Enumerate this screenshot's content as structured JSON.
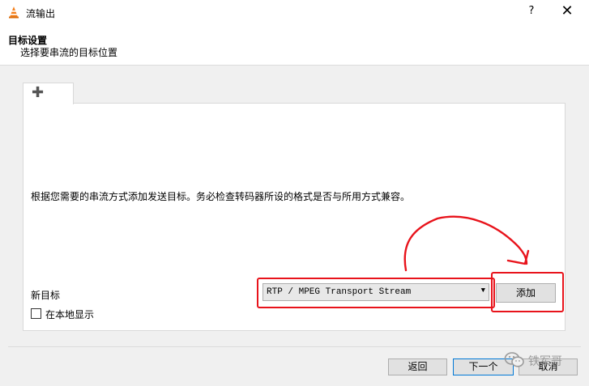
{
  "window": {
    "title": "流输出",
    "help_label": "?",
    "close_label": "✕",
    "icon": "vlc-cone-icon"
  },
  "header": {
    "title": "目标设置",
    "subtitle": "选择要串流的目标位置"
  },
  "tabs": [
    {
      "label": "✚",
      "icon": "add-icon"
    }
  ],
  "panel": {
    "instruction": "根据您需要的串流方式添加发送目标。务必检查转码器所设的格式是否与所用方式兼容。",
    "new_target_label": "新目标",
    "destination_select": {
      "value": "RTP / MPEG Transport Stream",
      "arrow": "▼"
    },
    "add_button": "添加",
    "local_display": {
      "label": "在本地显示",
      "checked": false
    }
  },
  "footer": {
    "back": "返回",
    "next": "下一个",
    "cancel": "取消"
  },
  "annotations": {
    "color": "#e8131b"
  },
  "watermark": {
    "text": "铁军哥",
    "icon": "wechat-icon"
  }
}
